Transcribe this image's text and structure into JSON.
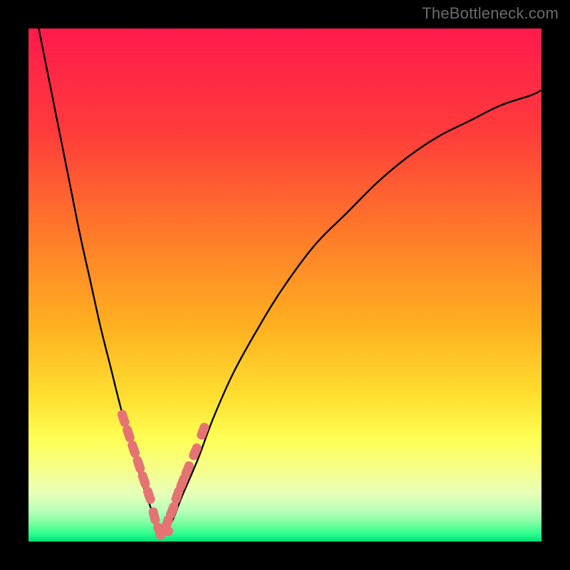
{
  "watermark": "TheBottleneck.com",
  "colors": {
    "frame": "#000000",
    "curve": "#000000",
    "markers": "#e57373",
    "gradient_stops": [
      {
        "offset": 0.0,
        "color": "#ff1a4d"
      },
      {
        "offset": 0.2,
        "color": "#ff3b3b"
      },
      {
        "offset": 0.4,
        "color": "#ff7a2a"
      },
      {
        "offset": 0.58,
        "color": "#ffb020"
      },
      {
        "offset": 0.72,
        "color": "#ffe030"
      },
      {
        "offset": 0.8,
        "color": "#ffff55"
      },
      {
        "offset": 0.86,
        "color": "#f6ff8a"
      },
      {
        "offset": 0.905,
        "color": "#e8ffb8"
      },
      {
        "offset": 0.94,
        "color": "#b9ffba"
      },
      {
        "offset": 0.965,
        "color": "#7affa0"
      },
      {
        "offset": 0.985,
        "color": "#2dff8e"
      },
      {
        "offset": 1.0,
        "color": "#00e07a"
      }
    ]
  },
  "chart_data": {
    "type": "line",
    "title": "",
    "xlabel": "",
    "ylabel": "",
    "xlim": [
      0,
      100
    ],
    "ylim": [
      0,
      100
    ],
    "grid": false,
    "series": [
      {
        "name": "bottleneck-curve",
        "x": [
          2,
          4,
          6,
          8,
          10,
          12,
          14,
          16,
          18,
          20,
          22,
          24,
          25,
          26,
          28,
          30,
          33,
          36,
          40,
          45,
          50,
          56,
          62,
          68,
          74,
          80,
          86,
          92,
          98,
          100
        ],
        "y": [
          100,
          90,
          80,
          70,
          60,
          51,
          42,
          34,
          26,
          19,
          12,
          6,
          2,
          1,
          4,
          9,
          16,
          24,
          33,
          42,
          50,
          58,
          64,
          70,
          75,
          79,
          82,
          85,
          87,
          88
        ]
      }
    ],
    "markers": {
      "name": "highlighted-points",
      "x": [
        18.5,
        19.5,
        20.5,
        21.5,
        22.5,
        23.5,
        24.5,
        25.5,
        26.5,
        27.0,
        28.0,
        29.0,
        30.0,
        31.0,
        32.5,
        34.0
      ],
      "y": [
        24.0,
        21.0,
        18.0,
        15.0,
        12.0,
        9.0,
        5.0,
        2.0,
        2.0,
        3.5,
        6.0,
        9.0,
        11.5,
        14.0,
        17.5,
        21.5
      ]
    }
  }
}
